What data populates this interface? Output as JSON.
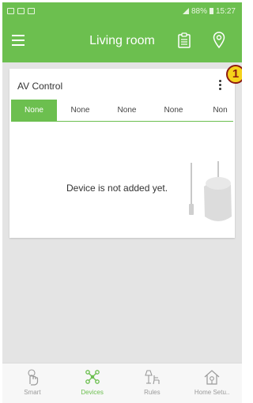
{
  "status_bar": {
    "battery": "88%",
    "time": "15:27"
  },
  "app_bar": {
    "title": "Living room"
  },
  "card": {
    "title": "AV Control",
    "badge": "1",
    "tabs": [
      "None",
      "None",
      "None",
      "None",
      "Non"
    ],
    "active_tab_index": 0,
    "empty_message": "Device is not added yet."
  },
  "bottom_nav": [
    {
      "label": "Smart",
      "icon": "smart-hand-icon"
    },
    {
      "label": "Devices",
      "icon": "devices-network-icon"
    },
    {
      "label": "Rules",
      "icon": "rules-lamp-chair-icon"
    },
    {
      "label": "Home Setu..",
      "icon": "home-setup-icon"
    }
  ],
  "colors": {
    "accent": "#6cbf4f",
    "badge_fill": "#f5d21b",
    "badge_border": "#8c1a10"
  }
}
